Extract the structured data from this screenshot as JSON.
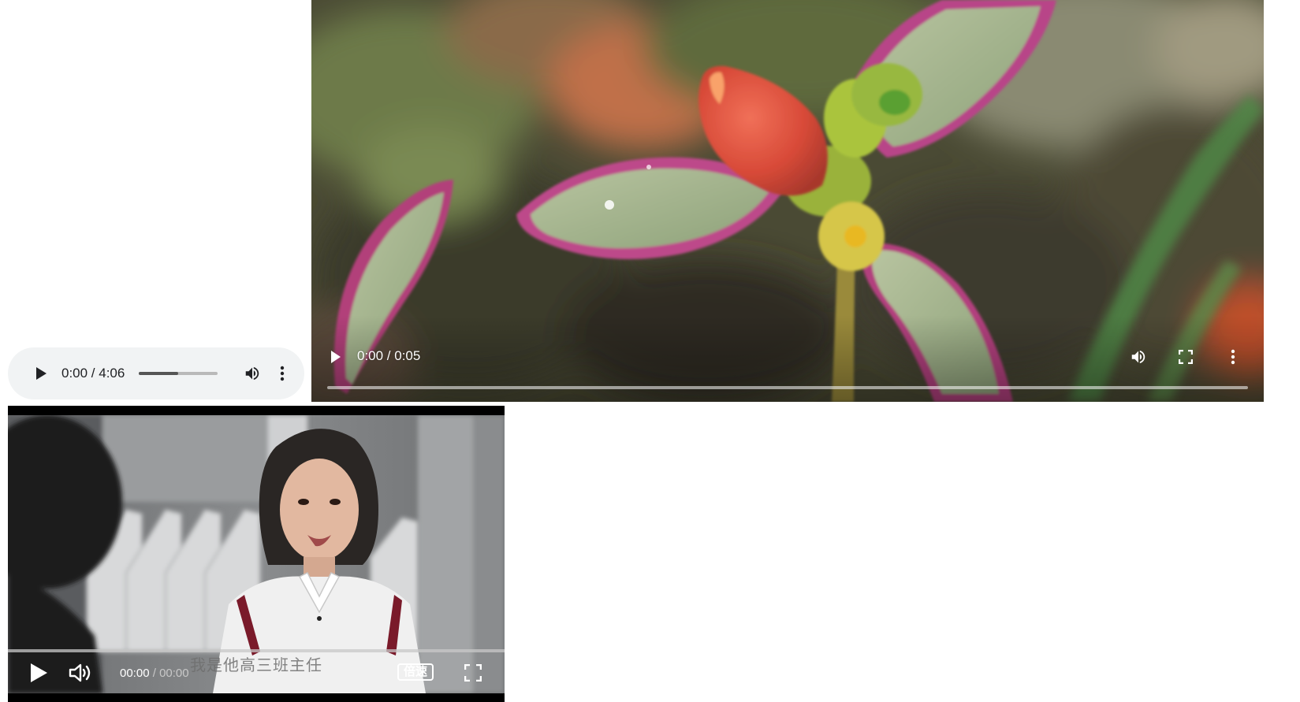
{
  "audio_player": {
    "time_display": "0:00 / 4:06",
    "volume_level": 0.5,
    "icons": [
      "play-icon",
      "volume-icon",
      "more-vert-icon"
    ]
  },
  "flower_video": {
    "time_display": "0:00 / 0:05",
    "icons": [
      "play-icon",
      "volume-icon",
      "fullscreen-icon",
      "more-vert-icon"
    ]
  },
  "drama_video": {
    "subtitle": "我是他高三班主任",
    "current_time": "00:00",
    "separator": "/",
    "total_time": "00:00",
    "rate_label": "倍速",
    "icons": [
      "play-icon",
      "volume-icon",
      "fullscreen-icon"
    ]
  },
  "colors": {
    "audio_background": "#f1f3f4",
    "audio_text": "#202124",
    "video_controls_text": "#ffffff",
    "drama_background": "#000000"
  }
}
